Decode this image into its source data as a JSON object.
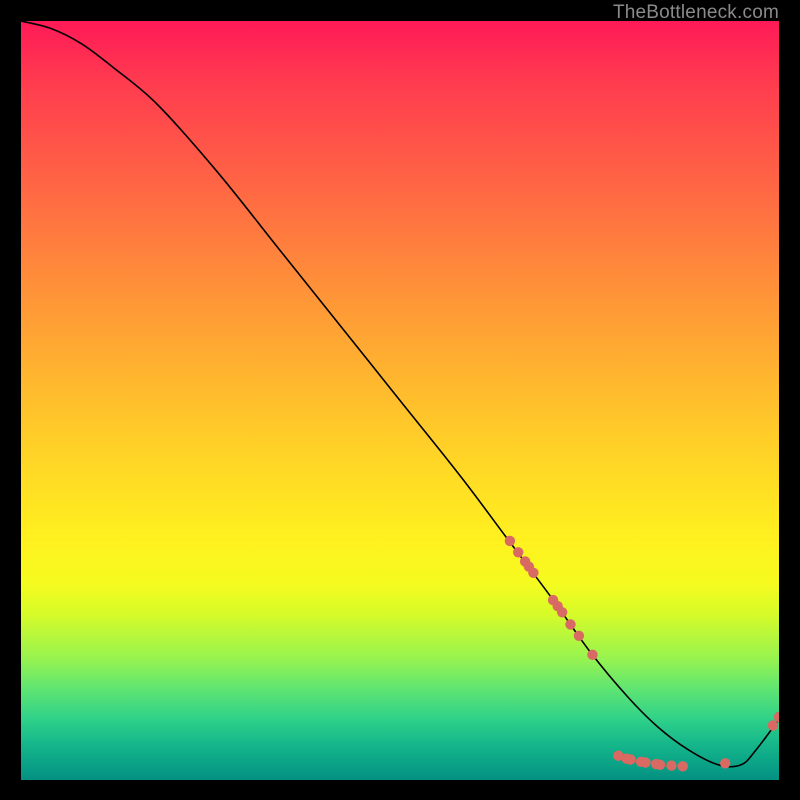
{
  "watermark": "TheBottleneck.com",
  "chart_data": {
    "type": "line",
    "title": "",
    "xlabel": "",
    "ylabel": "",
    "xlim": [
      0,
      100
    ],
    "ylim": [
      0,
      100
    ],
    "grid": false,
    "legend": null,
    "series": [
      {
        "name": "curve",
        "x": [
          0,
          4,
          8,
          12,
          18,
          26,
          34,
          42,
          50,
          58,
          64,
          70,
          75,
          80,
          84,
          88,
          92,
          95,
          97,
          100
        ],
        "y": [
          100,
          99,
          97,
          94,
          89,
          80,
          70,
          60,
          50,
          40,
          32,
          24,
          17,
          11,
          7,
          4,
          2,
          2,
          4,
          8
        ]
      }
    ],
    "markers": [
      {
        "x": 64.5,
        "y": 31.5
      },
      {
        "x": 65.6,
        "y": 30.0
      },
      {
        "x": 66.5,
        "y": 28.8
      },
      {
        "x": 67.0,
        "y": 28.1
      },
      {
        "x": 67.6,
        "y": 27.3
      },
      {
        "x": 70.2,
        "y": 23.7
      },
      {
        "x": 70.8,
        "y": 22.9
      },
      {
        "x": 71.4,
        "y": 22.1
      },
      {
        "x": 72.5,
        "y": 20.5
      },
      {
        "x": 73.6,
        "y": 19.0
      },
      {
        "x": 75.4,
        "y": 16.5
      },
      {
        "x": 78.8,
        "y": 3.2
      },
      {
        "x": 79.9,
        "y": 2.8
      },
      {
        "x": 80.4,
        "y": 2.7
      },
      {
        "x": 81.8,
        "y": 2.4
      },
      {
        "x": 82.4,
        "y": 2.3
      },
      {
        "x": 83.8,
        "y": 2.1
      },
      {
        "x": 84.3,
        "y": 2.0
      },
      {
        "x": 85.8,
        "y": 1.9
      },
      {
        "x": 87.3,
        "y": 1.8
      },
      {
        "x": 92.9,
        "y": 2.2
      },
      {
        "x": 99.2,
        "y": 7.2
      },
      {
        "x": 100.0,
        "y": 8.3
      }
    ],
    "marker_color": "#d86a63"
  }
}
